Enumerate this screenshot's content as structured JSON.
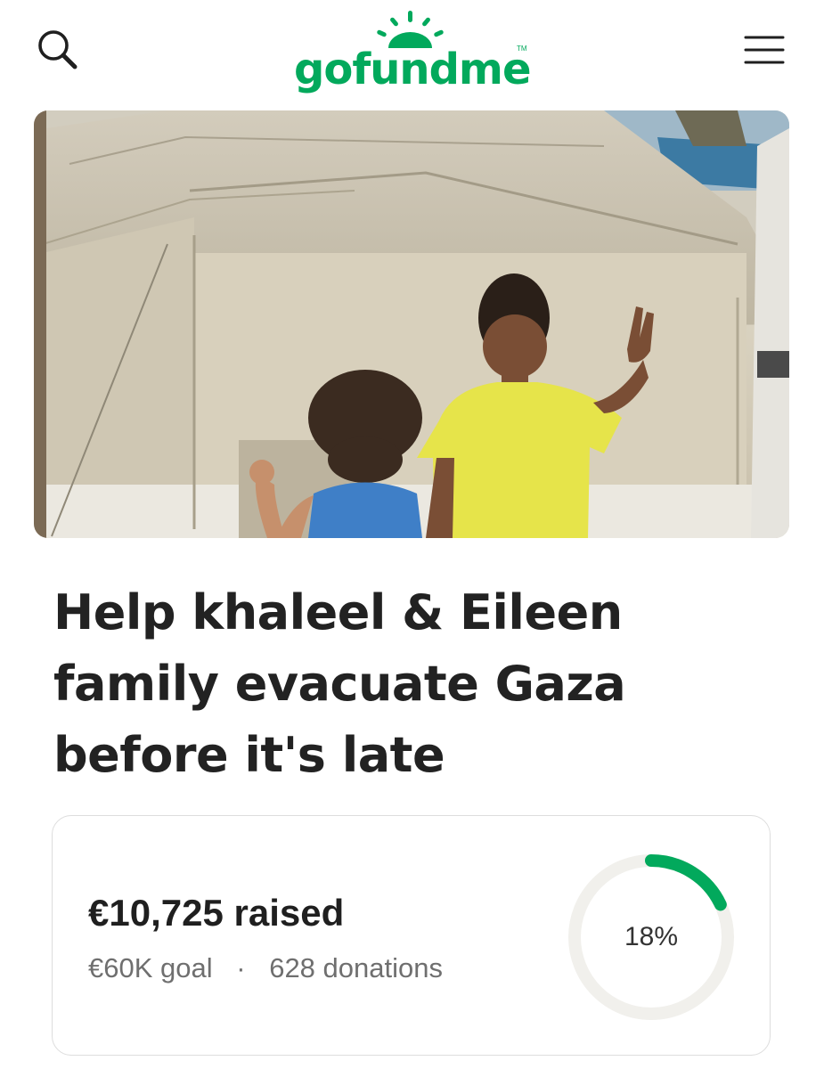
{
  "header": {
    "logo_text": "gofundme",
    "logo_tm": "TM",
    "search_icon": "search-icon",
    "menu_icon": "hamburger-menu-icon",
    "brand_color": "#02a95c"
  },
  "campaign": {
    "title": "Help khaleel & Eileen family evacuate Gaza before it's late"
  },
  "progress": {
    "raised": "€10,725 raised",
    "goal": "€60K goal",
    "separator": "·",
    "donations": "628 donations",
    "percent_label": "18%",
    "percent_value": 0.18,
    "ring_color": "#02a95c",
    "track_color": "#f1f0ec"
  }
}
